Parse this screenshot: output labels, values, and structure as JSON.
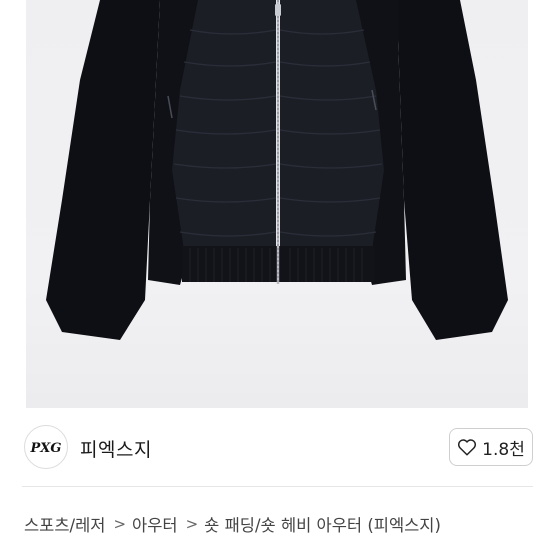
{
  "brand": {
    "name": "피엑스지",
    "logo_text": "PXG"
  },
  "like": {
    "count": "1.8천",
    "icon": "heart-outline-icon"
  },
  "breadcrumb": {
    "items": [
      "스포츠/레저",
      "아우터",
      "숏 패딩/숏 헤비 아우터 (피엑스지)"
    ],
    "separator": ">"
  },
  "colors": {
    "jacket": "#121318",
    "background": "#efeff1",
    "divider": "#e6e6e6"
  }
}
